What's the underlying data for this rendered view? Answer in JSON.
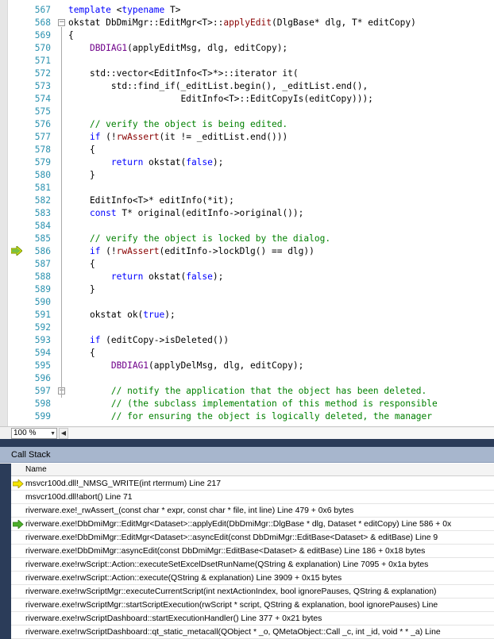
{
  "editor": {
    "zoom": "100 %",
    "lines": [
      {
        "n": "567",
        "fold": "",
        "tokens": [
          [
            "k",
            "template "
          ],
          [
            "p",
            "<"
          ],
          [
            "k",
            "typename"
          ],
          [
            "p",
            " T>"
          ]
        ]
      },
      {
        "n": "568",
        "fold": "minus",
        "tokens": [
          [
            "p",
            "okstat "
          ],
          [
            "p",
            "DbDmiMgr::EditMgr<T>::"
          ],
          [
            "f",
            "applyEdit"
          ],
          [
            "p",
            "(DlgBase* dlg, T* editCopy)"
          ]
        ]
      },
      {
        "n": "569",
        "fold": "",
        "tokens": [
          [
            "p",
            "{"
          ]
        ]
      },
      {
        "n": "570",
        "fold": "",
        "tokens": [
          [
            "p",
            "    "
          ],
          [
            "m",
            "DBDIAG1"
          ],
          [
            "p",
            "(applyEditMsg, dlg, editCopy);"
          ]
        ]
      },
      {
        "n": "571",
        "fold": "",
        "tokens": []
      },
      {
        "n": "572",
        "fold": "",
        "tokens": [
          [
            "p",
            "    std::vector<EditInfo<T>*>::iterator it("
          ]
        ]
      },
      {
        "n": "573",
        "fold": "",
        "tokens": [
          [
            "p",
            "        std::find_if(_editList.begin(), _editList.end(),"
          ]
        ]
      },
      {
        "n": "574",
        "fold": "",
        "tokens": [
          [
            "p",
            "                     EditInfo<T>::EditCopyIs(editCopy)));"
          ]
        ]
      },
      {
        "n": "575",
        "fold": "",
        "tokens": []
      },
      {
        "n": "576",
        "fold": "",
        "tokens": [
          [
            "p",
            "    "
          ],
          [
            "c",
            "// verify the object is being edited."
          ]
        ]
      },
      {
        "n": "577",
        "fold": "",
        "tokens": [
          [
            "p",
            "    "
          ],
          [
            "k",
            "if"
          ],
          [
            "p",
            " (!"
          ],
          [
            "f",
            "rwAssert"
          ],
          [
            "p",
            "(it != _editList.end()))"
          ]
        ]
      },
      {
        "n": "578",
        "fold": "",
        "tokens": [
          [
            "p",
            "    {"
          ]
        ]
      },
      {
        "n": "579",
        "fold": "",
        "tokens": [
          [
            "p",
            "        "
          ],
          [
            "k",
            "return"
          ],
          [
            "p",
            " okstat("
          ],
          [
            "k",
            "false"
          ],
          [
            "p",
            ");"
          ]
        ]
      },
      {
        "n": "580",
        "fold": "",
        "tokens": [
          [
            "p",
            "    }"
          ]
        ]
      },
      {
        "n": "581",
        "fold": "",
        "tokens": []
      },
      {
        "n": "582",
        "fold": "",
        "tokens": [
          [
            "p",
            "    EditInfo<T>* editInfo(*it);"
          ]
        ]
      },
      {
        "n": "583",
        "fold": "",
        "tokens": [
          [
            "p",
            "    "
          ],
          [
            "k",
            "const"
          ],
          [
            "p",
            " T* original(editInfo->original());"
          ]
        ]
      },
      {
        "n": "584",
        "fold": "",
        "tokens": []
      },
      {
        "n": "585",
        "fold": "",
        "tokens": [
          [
            "p",
            "    "
          ],
          [
            "c",
            "// verify the object is locked by the dialog."
          ]
        ]
      },
      {
        "n": "586",
        "fold": "",
        "tokens": [
          [
            "p",
            "    "
          ],
          [
            "k",
            "if"
          ],
          [
            "p",
            " (!"
          ],
          [
            "f",
            "rwAssert"
          ],
          [
            "p",
            "(editInfo->lockDlg() == dlg))"
          ]
        ]
      },
      {
        "n": "587",
        "fold": "",
        "tokens": [
          [
            "p",
            "    {"
          ]
        ]
      },
      {
        "n": "588",
        "fold": "",
        "tokens": [
          [
            "p",
            "        "
          ],
          [
            "k",
            "return"
          ],
          [
            "p",
            " okstat("
          ],
          [
            "k",
            "false"
          ],
          [
            "p",
            ");"
          ]
        ]
      },
      {
        "n": "589",
        "fold": "",
        "tokens": [
          [
            "p",
            "    }"
          ]
        ]
      },
      {
        "n": "590",
        "fold": "",
        "tokens": []
      },
      {
        "n": "591",
        "fold": "",
        "tokens": [
          [
            "p",
            "    okstat ok("
          ],
          [
            "k",
            "true"
          ],
          [
            "p",
            ");"
          ]
        ]
      },
      {
        "n": "592",
        "fold": "",
        "tokens": []
      },
      {
        "n": "593",
        "fold": "",
        "tokens": [
          [
            "p",
            "    "
          ],
          [
            "k",
            "if"
          ],
          [
            "p",
            " (editCopy->isDeleted())"
          ]
        ]
      },
      {
        "n": "594",
        "fold": "",
        "tokens": [
          [
            "p",
            "    {"
          ]
        ]
      },
      {
        "n": "595",
        "fold": "",
        "tokens": [
          [
            "p",
            "        "
          ],
          [
            "m",
            "DBDIAG1"
          ],
          [
            "p",
            "(applyDelMsg, dlg, editCopy);"
          ]
        ]
      },
      {
        "n": "596",
        "fold": "",
        "tokens": []
      },
      {
        "n": "597",
        "fold": "minus",
        "tokens": [
          [
            "p",
            "        "
          ],
          [
            "c",
            "// notify the application that the object has been deleted."
          ]
        ]
      },
      {
        "n": "598",
        "fold": "",
        "tokens": [
          [
            "p",
            "        "
          ],
          [
            "c",
            "// (the subclass implementation of this method is responsible"
          ]
        ]
      },
      {
        "n": "599",
        "fold": "",
        "tokens": [
          [
            "p",
            "        "
          ],
          [
            "c",
            "// for ensuring the object is logically deleted, the manager"
          ]
        ]
      }
    ]
  },
  "callstack": {
    "title": "Call Stack",
    "column_name": "Name",
    "rows": [
      {
        "icon": "yellow-arrow",
        "text": "msvcr100d.dll!_NMSG_WRITE(int rterrnum)  Line 217"
      },
      {
        "icon": "",
        "text": "msvcr100d.dll!abort()  Line 71"
      },
      {
        "icon": "",
        "text": "riverware.exe!_rwAssert_(const char * expr, const char * file, int line)  Line 479 + 0x6 bytes"
      },
      {
        "icon": "green-arrow",
        "text": "riverware.exe!DbDmiMgr::EditMgr<Dataset>::applyEdit(DbDmiMgr::DlgBase * dlg, Dataset * editCopy)  Line 586 + 0x"
      },
      {
        "icon": "",
        "text": "riverware.exe!DbDmiMgr::EditMgr<Dataset>::asyncEdit(const DbDmiMgr::EditBase<Dataset> & editBase)  Line 9"
      },
      {
        "icon": "",
        "text": "riverware.exe!DbDmiMgr::asyncEdit(const DbDmiMgr::EditBase<Dataset> & editBase)  Line 186 + 0x18 bytes"
      },
      {
        "icon": "",
        "text": "riverware.exe!rwScript::Action::executeSetExcelDsetRunName(QString & explanation)  Line 7095 + 0x1a bytes"
      },
      {
        "icon": "",
        "text": "riverware.exe!rwScript::Action::execute(QString & explanation)  Line 3909 + 0x15 bytes"
      },
      {
        "icon": "",
        "text": "riverware.exe!rwScriptMgr::executeCurrentScript(int nextActionIndex, bool ignorePauses, QString & explanation)"
      },
      {
        "icon": "",
        "text": "riverware.exe!rwScriptMgr::startScriptExecution(rwScript * script, QString & explanation, bool ignorePauses)  Line"
      },
      {
        "icon": "",
        "text": "riverware.exe!rwScriptDashboard::startExecutionHandler()  Line 377 + 0x21 bytes"
      },
      {
        "icon": "",
        "text": "riverware.exe!rwScriptDashboard::qt_static_metacall(QObject * _o, QMetaObject::Call _c, int _id, void * * _a)  Line"
      }
    ]
  },
  "colors": {
    "keyword": "#0000ff",
    "comment": "#008000",
    "macro": "#6f008a",
    "func": "#880000",
    "linenum": "#2b91af",
    "panel_title": "#a7b6cd",
    "dark": "#2b3c59"
  }
}
